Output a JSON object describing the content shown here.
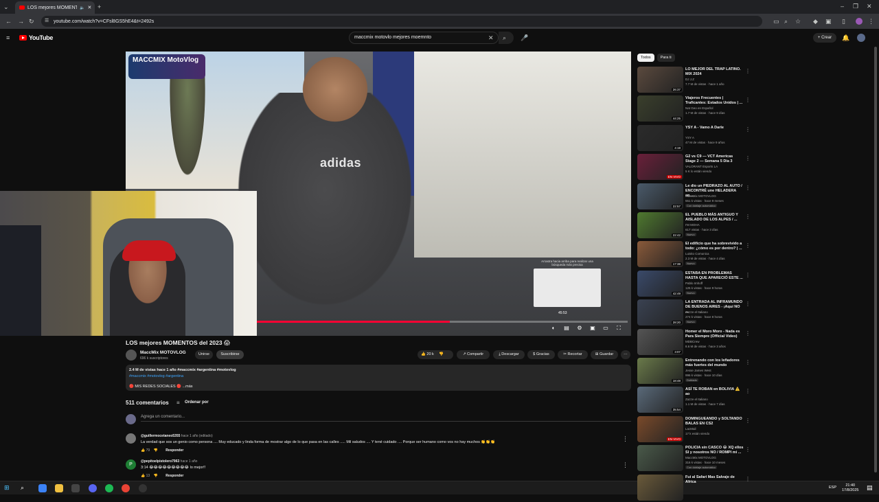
{
  "browser": {
    "tab_title": "LOS mejores MOMENTOS d",
    "url": "youtube.com/watch?v=CFsl8GS5hE4&t=2492s"
  },
  "youtube": {
    "logo_text": "YouTube",
    "search_query": "maccmix motovlo mejores moemnto",
    "create_label": "Crear"
  },
  "player": {
    "channel_watermark": "MACCMIX MotoVlog",
    "hint": "Arrastra hacia arriba para realizar una búsqueda más precisa",
    "preview_time": "45:53",
    "progress": 0.52
  },
  "video": {
    "title": "LOS mejores MOMENTOS del 2023 😱",
    "channel": "MaccMix MOTOVLOG",
    "subscribers": "696 k suscriptores",
    "join_label": "Unirse",
    "subscribed_label": "Suscribirse",
    "likes": "20 k",
    "share_label": "Compartir",
    "download_label": "Descargar",
    "thanks_label": "Gracias",
    "clip_label": "Recortar",
    "save_label": "Guardar",
    "description_stats": "2.4 M de vistas  hace 1 año  #maccmix #argentina #motovlog",
    "description_tags": "#maccmix #motovlog #argentina",
    "description_links": "🔴 MIS REDES SOCIALES 🔴  ...más"
  },
  "comments": {
    "count_label": "511 comentarios",
    "sort_label": "Ordenar por",
    "add_placeholder": "Agrega un comentario...",
    "items": [
      {
        "user": "@guillermocetaneo5355",
        "meta": "hace 1 año (editado)",
        "text": "La verdad que sos un genio como persona .... Muy educado  y linda forma de mostrar algo de lo que pasa en las  calles ..... Mil saludos  .... Y tené cuidado  .... Porque ser humano como vos no hay muchos 👏👏👏",
        "likes": "79",
        "reply_label": "Responder"
      },
      {
        "user": "@pepitoelpistolero7963",
        "meta": "hace 1 año",
        "text": "3:14 😂😂😂😂😂😂😂😂😂 lo mejor!!",
        "likes": "13",
        "reply_label": "Responder",
        "avatar_letter": "P"
      }
    ]
  },
  "sidebar": {
    "chips": [
      "Todos",
      "Para ti"
    ],
    "items": [
      {
        "title": "LO MEJOR DEL TRAP LATINO. MIX 2024",
        "channel": "DJ J.Z",
        "views": "7.7 M de vistas · hace 1 año",
        "duration": "26:37",
        "badge": "",
        "color": "#5b4a3e"
      },
      {
        "title": "Viajeros Frecuentes | Traficantes: Estados Unidos | ...",
        "channel": "Nat Geo en Español",
        "views": "1.7 M de vistas · hace 9 días",
        "duration": "44:25",
        "badge": "",
        "color": "#3a3f2c"
      },
      {
        "title": "YSY A - Vamo A Darle",
        "channel": "YSY A",
        "views": "47 M de vistas · hace 9 años",
        "duration": "4:19",
        "badge": "",
        "color": "#2b2b2b"
      },
      {
        "title": "G2 vs C9 — VCT Americas Stage 2 — Semana 5 Día 3",
        "channel": "VALORANT Esports LA",
        "views": "5 K lo están viendo",
        "duration": "EN VIVO",
        "badge": "",
        "color": "#6a1f3a"
      },
      {
        "title": "Le dio un PIEDRAZO AL AUTO / ENCONTRÉ une HELADERA en...",
        "channel": "MaccMix MOTOVLOG",
        "views": "551 k vistas · hace 9 meses",
        "duration": "22:57",
        "badge": "Con doblaje automático",
        "color": "#4a5a6a"
      },
      {
        "title": "EL PUEBLO MÁS ANTIGUO Y AISLADO DE LOS ALPES / ...",
        "channel": "I'M MOHA",
        "views": "617 vistas · hace 3 días",
        "duration": "22:42",
        "badge": "Nuevo",
        "color": "#4f7a2f"
      },
      {
        "title": "El edificio que ha sobrevivido a todo: ¿cómo es por dentro? | ...",
        "channel": "Luisito Comunica",
        "views": "2.3 M de vistas · hace 4 días",
        "duration": "17:38",
        "badge": "Nuevo",
        "color": "#8a5a3a"
      },
      {
        "title": "ESTABA EN PROBLEMAS HASTA QUE APARECIÓ ESTE ...",
        "channel": "Pablo Imhoff",
        "views": "125 k vistas · hace 9 horas",
        "duration": "42:49",
        "badge": "Nuevo",
        "color": "#3a4a6a"
      },
      {
        "title": "LA ENTRADA AL INFRAMUNDO DE BUENOS AIRES - ¡Aquí NO ...",
        "channel": "Zazze el Italiano",
        "views": "274 k vistas · hace 8 horas",
        "duration": "28:20",
        "badge": "Nuevo",
        "color": "#3a4252"
      },
      {
        "title": "Homer el Moro Moro - Nada es Para Siempre (Official Video)",
        "channel": "MDBCrew",
        "views": "8.6 M de vistas · hace 3 años",
        "duration": "3:07",
        "badge": "",
        "color": "#555"
      },
      {
        "title": "Entrenando con los leñadores más fuertes del mundo",
        "channel": "Jesse James West",
        "views": "996 k vistas · hace 10 días",
        "duration": "18:48",
        "badge": "Doblado",
        "color": "#6a7a4a"
      },
      {
        "title": "ASÍ TE ROBAN en BOLIVIA ⚠️ ao",
        "channel": "Zazze el Italiano",
        "views": "1.1 M de vistas · hace 7 días",
        "duration": "35:54",
        "badge": "",
        "color": "#5a6a7a"
      },
      {
        "title": "DOMINGUEANDO y SOLTANDO BALAS EN CS2",
        "channel": "LacMail",
        "views": "17 k están viendo",
        "duration": "EN VIVO",
        "badge": "",
        "color": "#7a4a2a"
      },
      {
        "title": "POLICIA sin CASCO 😂 XQ ellos SI y nosotros NO / ROMPI mi ...",
        "channel": "MaccMix MOTOVLOG",
        "views": "316 k vistas · hace 10 meses",
        "duration": "",
        "badge": "Con doblaje automático",
        "color": "#4a5a4a"
      },
      {
        "title": "Fui al Safari Mas Salvaje de Africa",
        "channel": "",
        "views": "",
        "duration": "",
        "badge": "",
        "color": "#6a5a3a"
      }
    ]
  },
  "taskbar": {
    "lang": "ESP",
    "time": "21:40",
    "date": "17/8/2025"
  }
}
